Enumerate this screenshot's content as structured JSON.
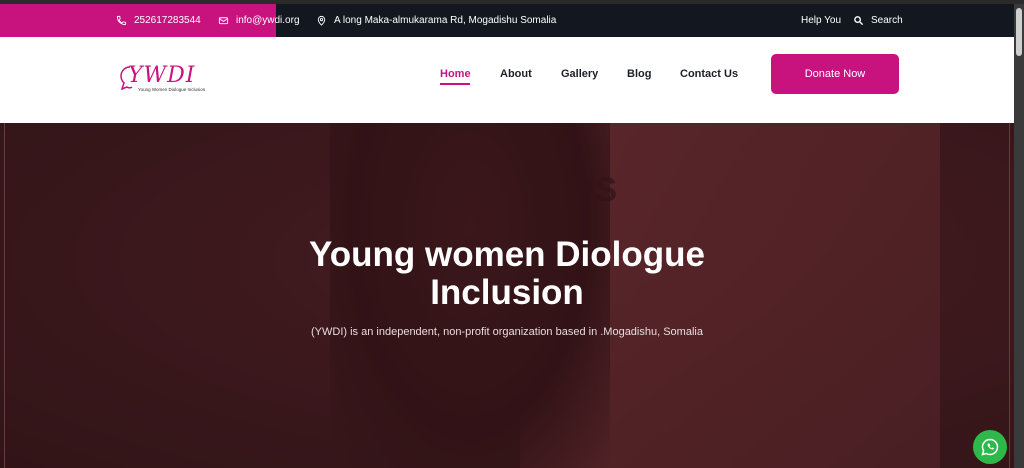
{
  "topbar": {
    "phone": "252617283544",
    "email": "info@ywdi.org",
    "address": "A long Maka-almukarama Rd, Mogadishu Somalia",
    "help": "Help You",
    "search": "Search"
  },
  "logo": {
    "word": "YWDI",
    "subtitle": "Young Women Diologue Inclusion"
  },
  "nav": {
    "items": [
      {
        "label": "Home",
        "active": true
      },
      {
        "label": "About"
      },
      {
        "label": "Gallery"
      },
      {
        "label": "Blog"
      },
      {
        "label": "Contact Us"
      }
    ],
    "donate": "Donate Now"
  },
  "hero": {
    "title_line1": "Young women Diologue",
    "title_line2": "Inclusion",
    "subtitle": "(YWDI) is an independent, non-profit organization based in .Mogadishu, Somalia",
    "poster_text": "US"
  },
  "colors": {
    "brand": "#c8137f",
    "topbar": "#131820",
    "whatsapp": "#2fb84a"
  },
  "icons": [
    "phone-icon",
    "email-icon",
    "location-icon",
    "search-icon",
    "whatsapp-icon"
  ]
}
